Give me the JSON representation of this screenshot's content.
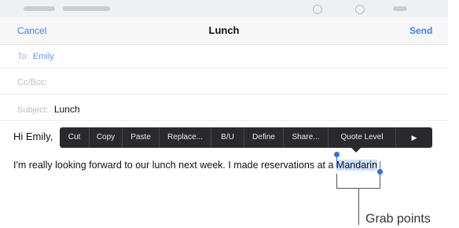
{
  "statusbar": {
    "icons": [
      "wifi-icon",
      "battery-icon"
    ]
  },
  "navbar": {
    "cancel_label": "Cancel",
    "title": "Lunch",
    "send_label": "Send"
  },
  "fields": {
    "to_label": "To:",
    "to_value": "Emily",
    "ccbcc_label": "Cc/Bcc:",
    "subject_label": "Subject:",
    "subject_value": "Lunch"
  },
  "body": {
    "greeting": "Hi Emily,",
    "line_prefix": "I'm really looking forward to our lunch next week. I made reservations at a ",
    "selected_word": "Mandarin"
  },
  "edit_menu": {
    "items": [
      "Cut",
      "Copy",
      "Paste",
      "Replace...",
      "B/U",
      "Define",
      "Share...",
      "Quote Level",
      "▶"
    ]
  },
  "callout": {
    "label": "Grab points"
  },
  "colors": {
    "accent": "#3b82f0",
    "menu_bg": "#2a2a2c",
    "selection": "#cfe1f8",
    "handle": "#2f6fe8"
  }
}
